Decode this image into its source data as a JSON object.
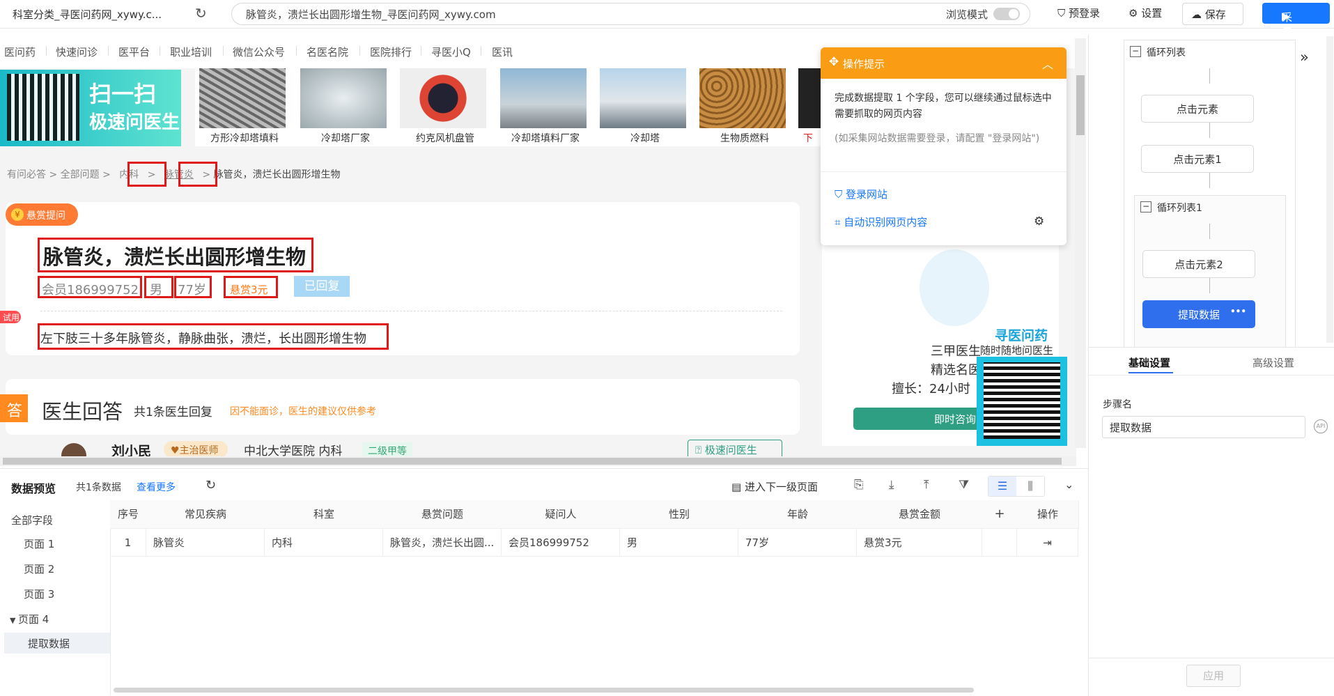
{
  "topbar": {
    "tab_title": "科室分类_寻医问药网_xywy.c...",
    "url": "脉管炎，溃烂长出圆形增生物_寻医问药网_xywy.com",
    "browse_mode_label": "浏览模式",
    "pre_login": "预登录",
    "settings": "设置",
    "save": "保存",
    "collect": "采集"
  },
  "site": {
    "nav": [
      "医问药",
      "快速问诊",
      "医平台",
      "职业培训",
      "微信公众号",
      "名医名院",
      "医院排行",
      "寻医小Q",
      "医讯"
    ],
    "banner": {
      "line1": "扫一扫",
      "line2": "极速问医生"
    },
    "products": [
      "方形冷却塔填料",
      "冷却塔厂家",
      "约克风机盘管",
      "冷却塔填料厂家",
      "冷却塔",
      "生物质燃料",
      "下"
    ],
    "breadcrumb": {
      "c1": "有问必答",
      "c2": "全部问题",
      "c3": "内科",
      "c4": "脉管炎",
      "c5": "脉管炎，溃烂长出圆形增生物",
      "sep": ">"
    },
    "question": {
      "reward_badge": "悬赏提问",
      "title": "脉管炎，溃烂长出圆形增生物",
      "member": "会员186999752",
      "gender": "男",
      "age": "77岁",
      "reward": "悬赏3元",
      "status": "已回复",
      "trial_tag": "试用",
      "description": "左下肢三十多年脉管炎，静脉曲张，溃烂，长出圆形增生物"
    },
    "answer": {
      "tag": "答",
      "title": "医生回答",
      "count": "共1条医生回复",
      "note": "因不能面诊，医生的建议仅供参考",
      "doctor_name": "刘小民",
      "doctor_rank": "主治医师",
      "doctor_hospital": "中北大学医院  内科",
      "hospital_level": "二级甲等",
      "quick_ask": "极速问医生"
    },
    "sidebar": {
      "line1": "三甲医生",
      "line2": "精选名医",
      "line3": "擅长：24小时",
      "consult": "即时咨询",
      "qr_title": "寻医问药",
      "qr_sub": "随时随地问医生"
    }
  },
  "tip": {
    "title": "操作提示",
    "body": "完成数据提取 1 个字段，您可以继续通过鼠标选中需要抓取的网页内容",
    "note": "(如采集网站数据需要登录，请配置 \"登录网站\")",
    "login_link": "登录网站",
    "auto_detect_link": "自动识别网页内容"
  },
  "flow": {
    "loop1": "循环列表",
    "step1": "点击元素",
    "step2": "点击元素1",
    "loop2": "循环列表1",
    "step3": "点击元素2",
    "step4": "提取数据",
    "more": "•••"
  },
  "settings": {
    "tab_basic": "基础设置",
    "tab_advanced": "高级设置",
    "step_name_label": "步骤名",
    "step_name_value": "提取数据",
    "api": "API",
    "apply": "应用"
  },
  "preview": {
    "title": "数据预览",
    "count": "共1条数据",
    "more": "查看更多",
    "next_level": "进入下一级页面",
    "fields_header": "全部字段",
    "pages": [
      "页面 1",
      "页面 2",
      "页面 3",
      "页面 4"
    ],
    "selected_field": "提取数据",
    "columns": [
      "序号",
      "常见疾病",
      "科室",
      "悬赏问题",
      "疑问人",
      "性别",
      "年龄",
      "悬赏金额",
      "+",
      "操作"
    ],
    "rows": [
      [
        "1",
        "脉管炎",
        "内科",
        "脉管炎，溃烂长出圆...",
        "会员186999752",
        "男",
        "77岁",
        "悬赏3元",
        "",
        "⇥"
      ]
    ]
  }
}
